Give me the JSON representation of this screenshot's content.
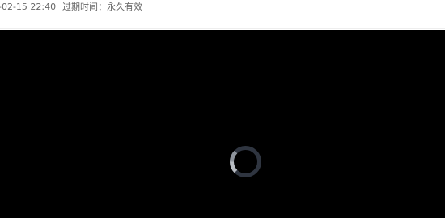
{
  "meta": {
    "publish_time": "-02-15 22:40",
    "expiry": "过期时间：永久有效"
  },
  "player": {
    "state": "loading",
    "background_color": "#000000",
    "spinner_track_color": "#2f3540",
    "spinner_arc_color": "#b8bcc2",
    "spinner_icon": "loading-spinner-icon"
  }
}
